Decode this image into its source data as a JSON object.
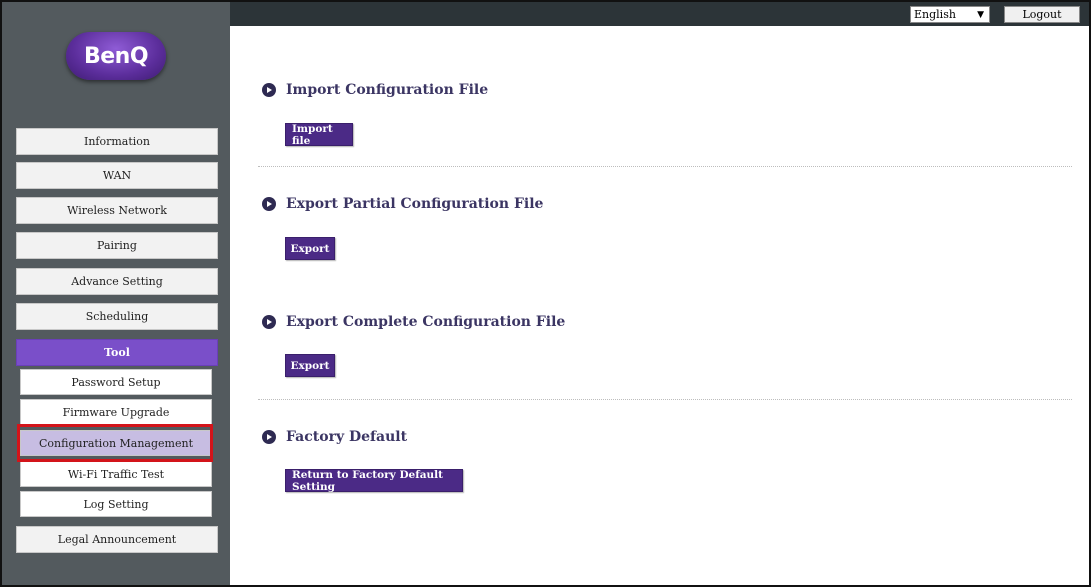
{
  "brand": {
    "logo_text": "BenQ",
    "accent_color": "#7a4fc9"
  },
  "header": {
    "language": "English",
    "language_arrow": "▼",
    "logout_label": "Logout"
  },
  "sidebar": {
    "items": [
      {
        "label": "Information"
      },
      {
        "label": "WAN"
      },
      {
        "label": "Wireless Network"
      },
      {
        "label": "Pairing"
      },
      {
        "label": "Advance Setting"
      },
      {
        "label": "Scheduling"
      },
      {
        "label": "Tool"
      },
      {
        "label": "Legal Announcement"
      }
    ],
    "sub_items": [
      {
        "label": "Password Setup"
      },
      {
        "label": "Firmware Upgrade"
      },
      {
        "label": "Configuration Management"
      },
      {
        "label": "Wi-Fi Traffic Test"
      },
      {
        "label": "Log Setting"
      }
    ]
  },
  "main": {
    "sections": [
      {
        "title": "Import Configuration File",
        "button": "Import file"
      },
      {
        "title": "Export Partial Configuration File",
        "button": "Export"
      },
      {
        "title": "Export Complete Configuration File",
        "button": "Export"
      },
      {
        "title": "Factory Default",
        "button": "Return to Factory Default Setting"
      }
    ]
  }
}
